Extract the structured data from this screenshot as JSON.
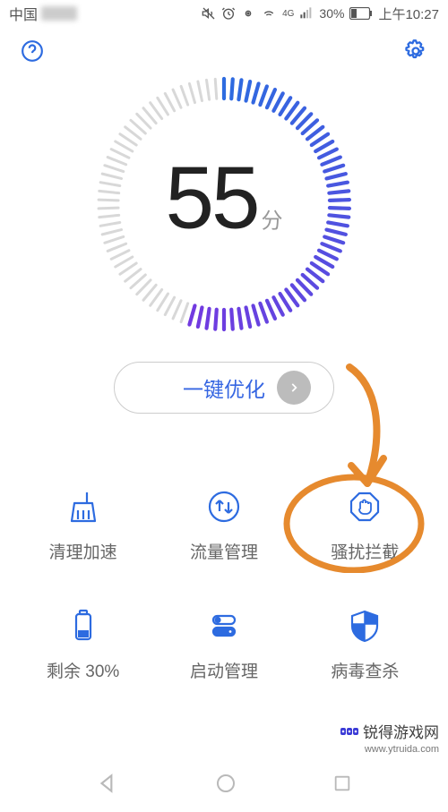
{
  "status_bar": {
    "carrier": "中国",
    "network_label": "4G",
    "battery_percent": "30%",
    "clock": "上午10:27"
  },
  "gauge": {
    "score": "55",
    "unit": "分",
    "progress": 55
  },
  "optimize": {
    "button_label": "一键优化"
  },
  "features": {
    "cleanup": "清理加速",
    "data_usage": "流量管理",
    "harassment": "骚扰拦截",
    "battery_remaining": "剩余 30%",
    "startup": "启动管理",
    "virus": "病毒查杀"
  },
  "watermark": {
    "main": "锐得游戏网",
    "sub": "www.ytruida.com"
  }
}
